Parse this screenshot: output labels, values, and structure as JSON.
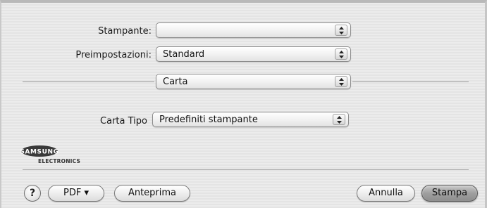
{
  "printer": {
    "label": "Stampante:",
    "value": ""
  },
  "presets": {
    "label": "Preimpostazioni:",
    "value": "Standard"
  },
  "section": {
    "value": "Carta"
  },
  "paper_type": {
    "label": "Carta Tipo",
    "value": "Predefiniti stampante"
  },
  "logo": {
    "brand": "SAMSUNG",
    "sub": "ELECTRONICS"
  },
  "footer": {
    "help": "?",
    "pdf": "PDF ▾",
    "preview": "Anteprima",
    "cancel": "Annulla",
    "print": "Stampa"
  }
}
